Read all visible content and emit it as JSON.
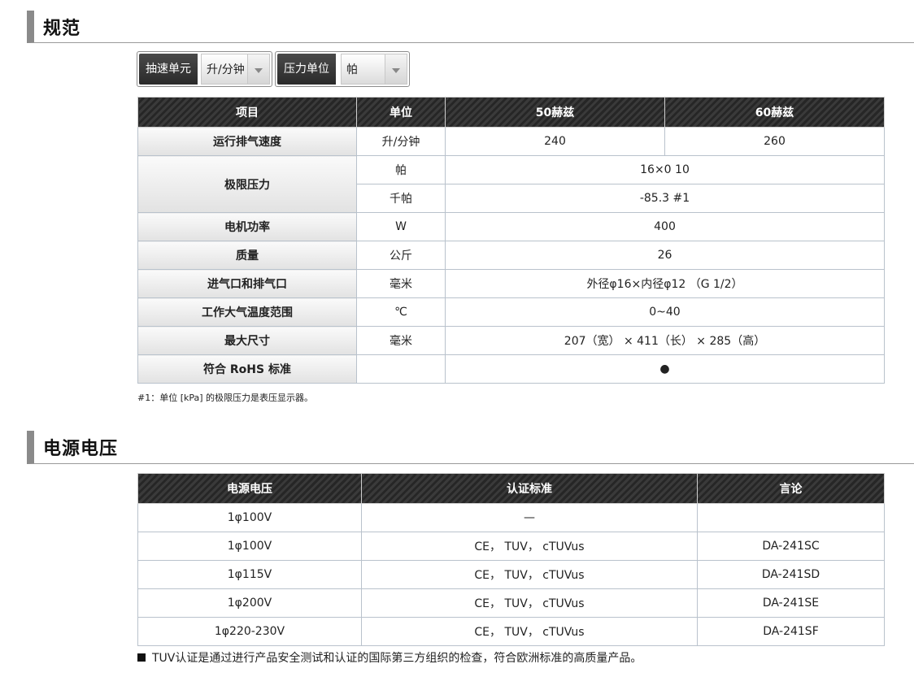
{
  "sections": {
    "spec_title": "规范",
    "power_title": "电源电压"
  },
  "controls": {
    "speed_unit_label": "抽速单元",
    "speed_unit_value": "升/分钟",
    "pressure_unit_label": "压力单位",
    "pressure_unit_value": "帕"
  },
  "spec_table": {
    "headers": [
      "项目",
      "单位",
      "50赫兹",
      "60赫兹"
    ],
    "rows": {
      "exhaust_speed": {
        "label": "运行排气速度",
        "unit": "升/分钟",
        "v50": "240",
        "v60": "260"
      },
      "ultimate_pressure": {
        "label": "极限压力",
        "unit_pa": "帕",
        "value_pa": "16×0 10",
        "unit_kpa": "千帕",
        "value_kpa": "-85.3 #1"
      },
      "motor_power": {
        "label": "电机功率",
        "unit": "W",
        "value": "400"
      },
      "mass": {
        "label": "质量",
        "unit": "公斤",
        "value": "26"
      },
      "ports": {
        "label": "进气口和排气口",
        "unit": "毫米",
        "value": "外径φ16×内径φ12 （G 1/2）"
      },
      "temperature": {
        "label": "工作大气温度范围",
        "unit": "℃",
        "value": "0~40"
      },
      "dimensions": {
        "label": "最大尺寸",
        "unit": "毫米",
        "value": "207（宽） × 411（长） × 285（高）"
      },
      "rohs": {
        "label": "符合 RoHS 标准",
        "unit": "",
        "value": "●"
      }
    },
    "footnote": "#1：单位 [kPa] 的极限压力是表压显示器。"
  },
  "power_table": {
    "headers": [
      "电源电压",
      "认证标准",
      "言论"
    ],
    "rows": [
      {
        "voltage": "1φ100V",
        "standard": "—",
        "remark": ""
      },
      {
        "voltage": "1φ100V",
        "standard": "CE， TUV， cTUVus",
        "remark": "DA-241SC"
      },
      {
        "voltage": "1φ115V",
        "standard": "CE， TUV， cTUVus",
        "remark": "DA-241SD"
      },
      {
        "voltage": "1φ200V",
        "standard": "CE， TUV， cTUVus",
        "remark": "DA-241SE"
      },
      {
        "voltage": "1φ220-230V",
        "standard": "CE， TUV， cTUVus",
        "remark": "DA-241SF"
      }
    ],
    "note": "TUV认证是通过进行产品安全测试和认证的国际第三方组织的检查，符合欧洲标准的高质量产品。"
  }
}
